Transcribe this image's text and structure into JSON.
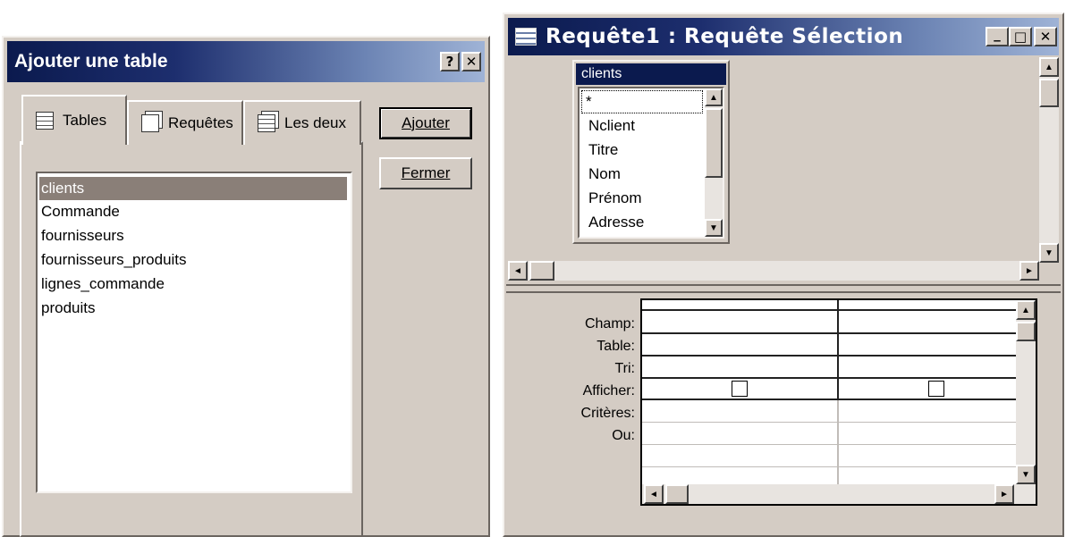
{
  "dialog": {
    "title": "Ajouter une table",
    "help_glyph": "?",
    "close_glyph": "✕",
    "tabs": [
      {
        "label": "Tables",
        "icon": "table-icon"
      },
      {
        "label": "Requêtes",
        "icon": "query-icon"
      },
      {
        "label": "Les deux",
        "icon": "both-icon"
      }
    ],
    "active_tab": "Tables",
    "items": [
      "clients",
      "Commande",
      "fournisseurs",
      "fournisseurs_produits",
      "lignes_commande",
      "produits"
    ],
    "selected_item": "clients",
    "add_button": "Ajouter",
    "close_button": "Fermer"
  },
  "query": {
    "title": "Requête1 : Requête Sélection",
    "table_box": {
      "name": "clients",
      "fields": [
        "*",
        "Nclient",
        "Titre",
        "Nom",
        "Prénom",
        "Adresse"
      ]
    },
    "grid_labels": [
      "Champ:",
      "Table:",
      "Tri:",
      "Afficher:",
      "Critères:",
      "Ou:"
    ],
    "minimize_glyph": "_",
    "maximize_glyph": "□",
    "close_glyph": "✕"
  },
  "colors": {
    "window_bg": "#d4ccc4",
    "title_dark": "#0b1a4e",
    "selection": "#8a7f78"
  }
}
